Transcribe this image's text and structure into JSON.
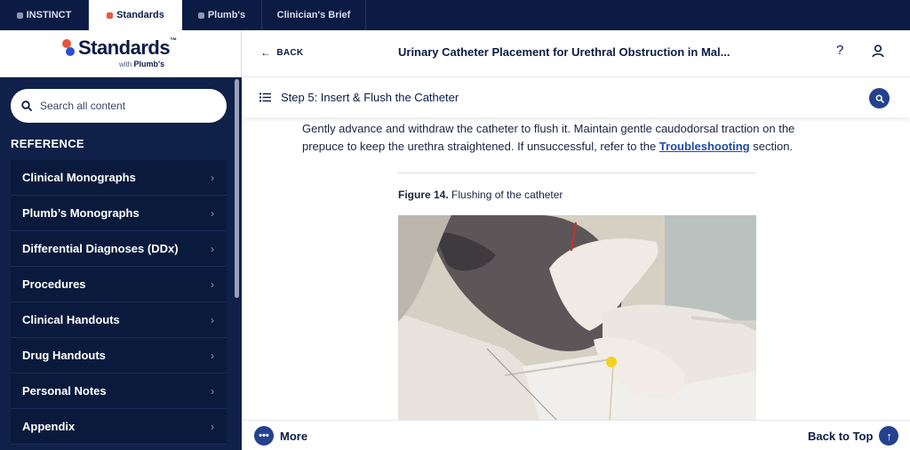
{
  "product_tabs": [
    {
      "label": "INSTINCT"
    },
    {
      "label": "Standards"
    },
    {
      "label": "Plumb's"
    },
    {
      "label": "Clinician's Brief"
    }
  ],
  "logo": {
    "name": "Standards",
    "tm": "™",
    "with": "with",
    "partner": "Plumb's"
  },
  "search": {
    "placeholder": "Search all content"
  },
  "sidebar": {
    "section_label": "REFERENCE",
    "items": [
      {
        "label": "Clinical Monographs"
      },
      {
        "label": "Plumb’s Monographs"
      },
      {
        "label": "Differential Diagnoses (DDx)"
      },
      {
        "label": "Procedures"
      },
      {
        "label": "Clinical Handouts"
      },
      {
        "label": "Drug Handouts"
      },
      {
        "label": "Personal Notes"
      },
      {
        "label": "Appendix"
      }
    ]
  },
  "header": {
    "back_label": "BACK",
    "title": "Urinary Catheter Placement for Urethral Obstruction in Mal...",
    "help": "?"
  },
  "step": {
    "title": "Step 5: Insert & Flush the Catheter"
  },
  "content": {
    "paragraph_before": "Gently advance and withdraw the catheter to flush it. Maintain gentle caudodorsal traction on the prepuce to keep the urethra straightened. If unsuccessful, refer to the ",
    "link_text": "Troubleshooting",
    "paragraph_after": " section.",
    "figure_label": "Figure 14.",
    "figure_caption": " Flushing of the catheter"
  },
  "bottom": {
    "more_label": "More",
    "back_to_top_label": "Back to Top"
  },
  "colors": {
    "navy": "#0b1b44",
    "sidebar": "#0f2149",
    "accent": "#24418f",
    "logo_red": "#e8543a",
    "logo_blue": "#2f4fd1"
  }
}
